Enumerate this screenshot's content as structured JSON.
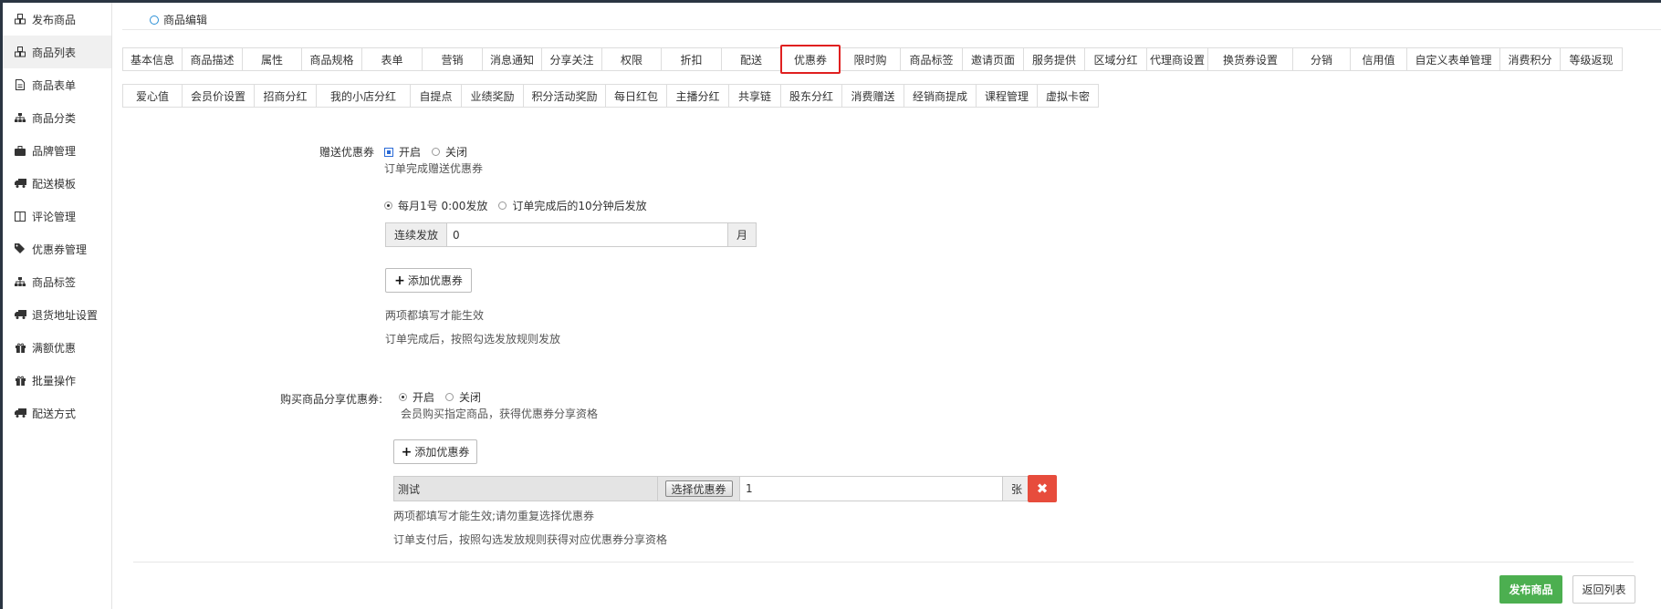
{
  "sidebar": {
    "items": [
      {
        "label": "发布商品",
        "icon": "cubes-icon"
      },
      {
        "label": "商品列表",
        "icon": "cubes-icon"
      },
      {
        "label": "商品表单",
        "icon": "file-icon"
      },
      {
        "label": "商品分类",
        "icon": "sitemap-icon"
      },
      {
        "label": "品牌管理",
        "icon": "briefcase-icon"
      },
      {
        "label": "配送模板",
        "icon": "truck-icon"
      },
      {
        "label": "评论管理",
        "icon": "columns-icon"
      },
      {
        "label": "优惠券管理",
        "icon": "tags-icon"
      },
      {
        "label": "商品标签",
        "icon": "sitemap-icon"
      },
      {
        "label": "退货地址设置",
        "icon": "truck-icon"
      },
      {
        "label": "满额优惠",
        "icon": "gift-icon"
      },
      {
        "label": "批量操作",
        "icon": "gift-icon"
      },
      {
        "label": "配送方式",
        "icon": "truck-icon"
      }
    ],
    "active_index": 1
  },
  "breadcrumb": {
    "label": "商品编辑"
  },
  "tabs_row1": [
    "基本信息",
    "商品描述",
    "属性",
    "商品规格",
    "表单",
    "营销",
    "消息通知",
    "分享关注",
    "权限",
    "折扣",
    "配送",
    "优惠券",
    "限时购",
    "商品标签",
    "邀请页面",
    "服务提供",
    "区域分红",
    "代理商设置",
    "换货券设置",
    "分销",
    "信用值",
    "自定义表单管理",
    "消费积分",
    "等级返现"
  ],
  "tabs_row2": [
    "爱心值",
    "会员价设置",
    "招商分红",
    "我的小店分红",
    "自提点",
    "业绩奖励",
    "积分活动奖励",
    "每日红包",
    "主播分红",
    "共享链",
    "股东分红",
    "消费赠送",
    "经销商提成",
    "课程管理",
    "虚拟卡密"
  ],
  "active_tab": "优惠券",
  "gift_coupon": {
    "label": "赠送优惠券",
    "on_label": "开启",
    "off_label": "关闭",
    "enabled": true,
    "hint": "订单完成赠送优惠券",
    "schedule_opt1": "每月1号 0:00发放",
    "schedule_opt2": "订单完成后的10分钟后发放",
    "continuous_label": "连续发放",
    "continuous_value": "0",
    "month_unit": "月",
    "add_button": "添加优惠券",
    "note1": "两项都填写才能生效",
    "note2": "订单完成后，按照勾选发放规则发放"
  },
  "share_coupon": {
    "label": "购买商品分享优惠券:",
    "on_label": "开启",
    "off_label": "关闭",
    "enabled": true,
    "hint": "会员购买指定商品，获得优惠券分享资格",
    "add_button": "添加优惠券",
    "coupon_name": "测试",
    "select_button": "选择优惠券",
    "quantity": "1",
    "unit": "张",
    "note1": "两项都填写才能生效;请勿重复选择优惠券",
    "note2": "订单支付后，按照勾选发放规则获得对应优惠券分享资格"
  },
  "footer": {
    "publish": "发布商品",
    "back": "返回列表"
  },
  "colors": {
    "active_tab_border": "#e02020",
    "publish_bg": "#4caf50",
    "delete_bg": "#e74c3c",
    "sidebar_dark": "#2a3542"
  }
}
